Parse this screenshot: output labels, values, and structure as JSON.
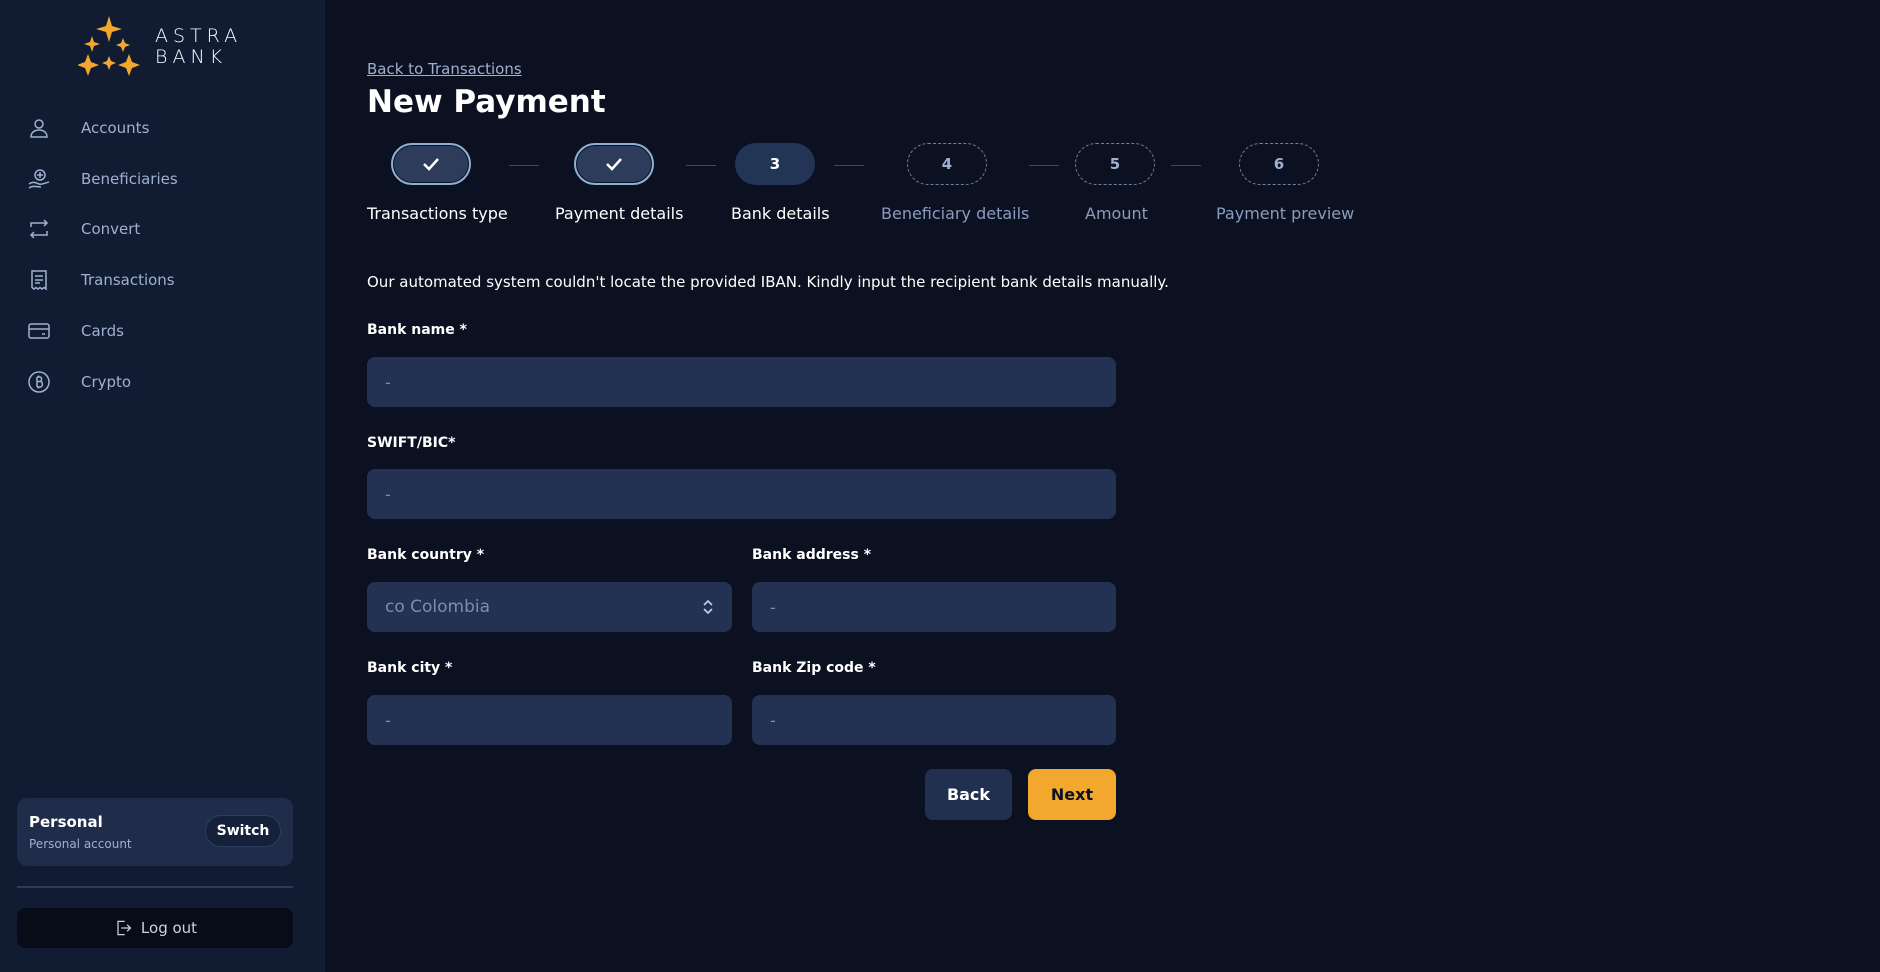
{
  "brand": {
    "line1": "ASTRA",
    "line2": "BANK",
    "accent": "#f2a72d"
  },
  "sidebar": {
    "items": [
      {
        "label": "Accounts",
        "icon": "user-icon"
      },
      {
        "label": "Beneficiaries",
        "icon": "beneficiaries-icon"
      },
      {
        "label": "Convert",
        "icon": "convert-icon"
      },
      {
        "label": "Transactions",
        "icon": "receipt-icon"
      },
      {
        "label": "Cards",
        "icon": "card-icon"
      },
      {
        "label": "Crypto",
        "icon": "bitcoin-icon"
      }
    ],
    "account": {
      "name": "Personal",
      "type": "Personal account",
      "switch_label": "Switch"
    },
    "logout_label": "Log out"
  },
  "header": {
    "back_link": "Back to Transactions",
    "title": "New Payment"
  },
  "stepper": {
    "steps": [
      {
        "number": "",
        "label": "Transactions type",
        "state": "done"
      },
      {
        "number": "",
        "label": "Payment details",
        "state": "done"
      },
      {
        "number": "3",
        "label": "Bank details",
        "state": "active"
      },
      {
        "number": "4",
        "label": "Beneficiary details",
        "state": "pending"
      },
      {
        "number": "5",
        "label": "Amount",
        "state": "pending"
      },
      {
        "number": "6",
        "label": "Payment preview",
        "state": "pending"
      }
    ]
  },
  "form": {
    "notice": "Our automated system couldn't locate the provided IBAN. Kindly input the recipient bank details manually.",
    "bank_name": {
      "label": "Bank name *",
      "placeholder": "-",
      "value": ""
    },
    "swift": {
      "label": "SWIFT/BIC*",
      "placeholder": "-",
      "value": ""
    },
    "country": {
      "label": "Bank country *",
      "value": "co Colombia"
    },
    "address": {
      "label": "Bank address *",
      "placeholder": "-",
      "value": ""
    },
    "city": {
      "label": "Bank city *",
      "placeholder": "-",
      "value": ""
    },
    "zip": {
      "label": "Bank Zip code *",
      "placeholder": "-",
      "value": ""
    },
    "back_label": "Back",
    "next_label": "Next"
  }
}
